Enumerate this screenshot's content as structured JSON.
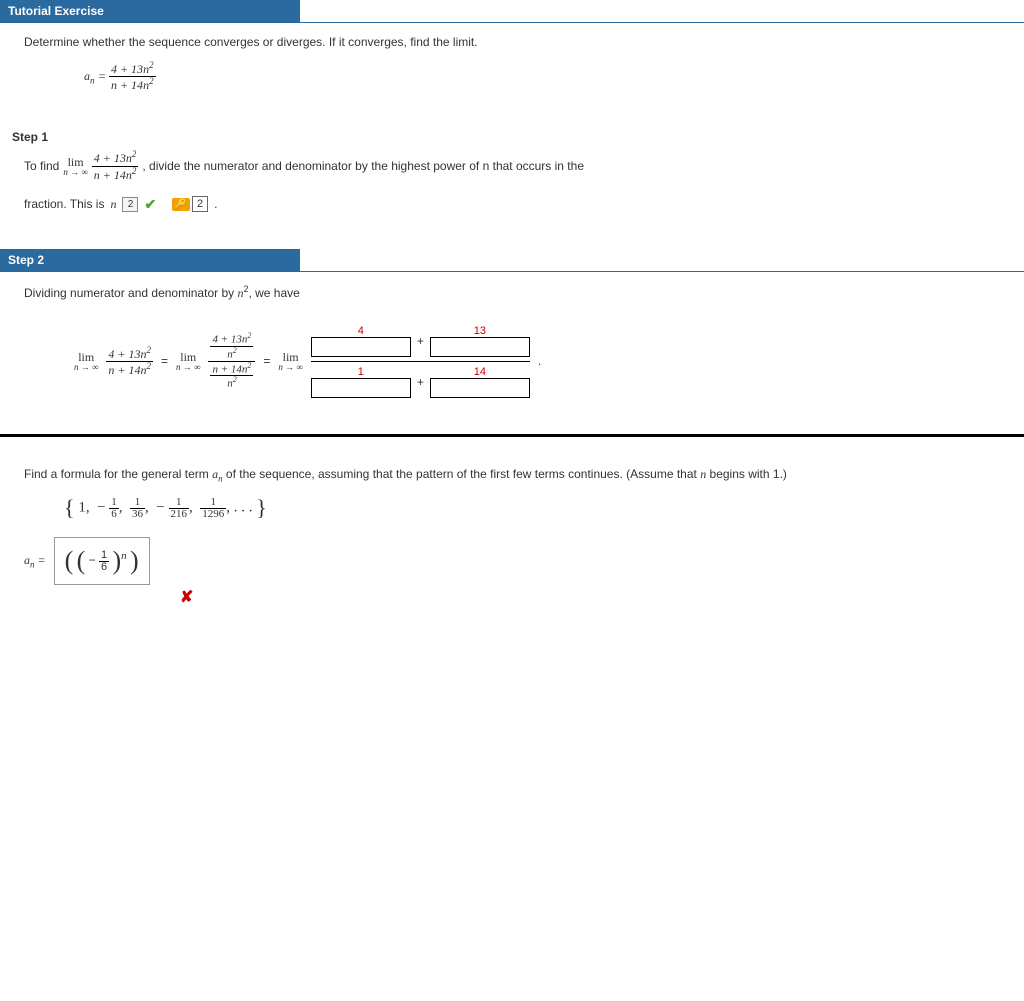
{
  "tutorial": {
    "header": "Tutorial Exercise",
    "question": "Determine whether the sequence converges or diverges. If it converges, find the limit.",
    "formula": {
      "an": "aₙ =",
      "num": "4 + 13n²",
      "den": "n + 14n²"
    }
  },
  "step1": {
    "label": "Step 1",
    "text1": "To find",
    "lim_top": "lim",
    "lim_bot": "n → ∞",
    "frac_num": "4 + 13n²",
    "frac_den": "n + 14n²",
    "text2": ", divide the numerator and denominator by the highest power of n that occurs in the",
    "text3": "fraction. This is",
    "n_var": "n",
    "ans_exp": "2",
    "key_val": "2"
  },
  "step2": {
    "label": "Step 2",
    "text": "Dividing numerator and denominator by n², we have",
    "lim_top": "lim",
    "lim_bot": "n → ∞",
    "equals": " = ",
    "f1_num": "4 + 13n²",
    "f1_den": "n + 14n²",
    "f2_top_num": "4 + 13n²",
    "f2_top_den": "n²",
    "f2_bot_num": "n + 14n²",
    "f2_bot_den": "n²",
    "hints": {
      "a": "4",
      "b": "13",
      "c": "1",
      "d": "14"
    },
    "plus": "+",
    "period": "."
  },
  "problem2": {
    "text": "Find a formula for the general term aₙ of the sequence, assuming that the pattern of the first few terms continues. (Assume that n begins with 1.)",
    "seq_parts": {
      "t1": "1,",
      "t2": "−",
      "f1n": "1",
      "f1d": "6",
      "c1": ",",
      "f2n": "1",
      "f2d": "36",
      "c2": ",",
      "t3": "−",
      "f3n": "1",
      "f3d": "216",
      "c3": ",",
      "f4n": "1",
      "f4d": "1296",
      "c4": ", . . ."
    },
    "an_label": "aₙ =",
    "answer_inner_num": "1",
    "answer_inner_den": "6",
    "answer_minus": "−",
    "answer_exp": "n"
  }
}
